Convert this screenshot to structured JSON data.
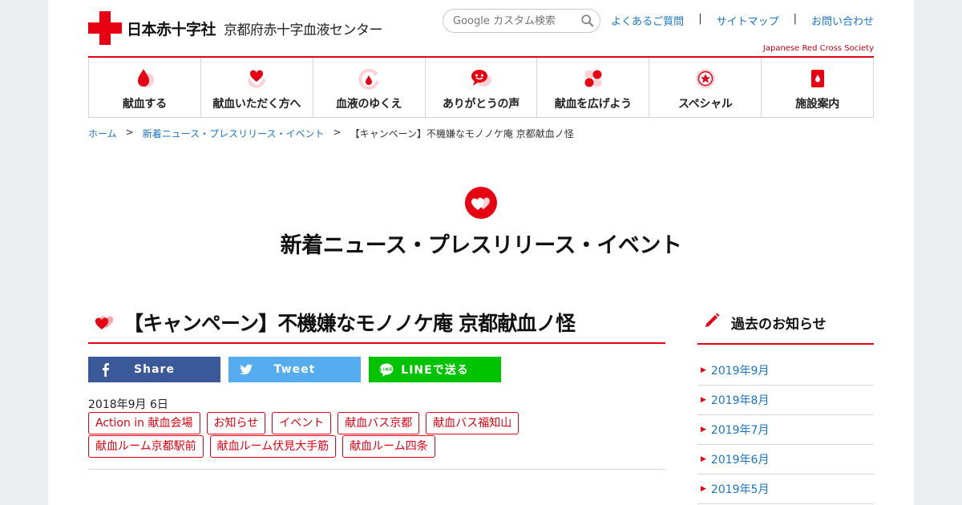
{
  "header": {
    "logo_text": "日本赤十字社",
    "center_name": "京都府赤十字血液センター",
    "search_placeholder": "Google カスタム検索",
    "links": [
      "よくあるご質問",
      "サイトマップ",
      "お問い合わせ"
    ],
    "separator": "|",
    "society_en": "Japanese Red Cross Society"
  },
  "nav": [
    {
      "label": "献血する",
      "icon": "blood-drop-icon"
    },
    {
      "label": "献血いただく方へ",
      "icon": "heart-hands-icon"
    },
    {
      "label": "血液のゆくえ",
      "icon": "circulation-icon"
    },
    {
      "label": "ありがとうの声",
      "icon": "speech-bubble-icon"
    },
    {
      "label": "献血を広げよう",
      "icon": "clover-icon"
    },
    {
      "label": "スペシャル",
      "icon": "star-badge-icon"
    },
    {
      "label": "施設案内",
      "icon": "building-card-icon"
    }
  ],
  "breadcrumb": {
    "home": "ホーム",
    "section": "新着ニュース・プレスリリース・イベント",
    "separator": ">",
    "current": "【キャンペーン】不機嫌なモノノケ庵 京都献血ノ怪"
  },
  "section": {
    "title": "新着ニュース・プレスリリース・イベント"
  },
  "article": {
    "title": "【キャンペーン】不機嫌なモノノケ庵 京都献血ノ怪",
    "share": {
      "facebook": "Share",
      "twitter": "Tweet",
      "line": "LINEで送る"
    },
    "date": "2018年9月 6日",
    "tags": [
      "Action in 献血会場",
      "お知らせ",
      "イベント",
      "献血バス京都",
      "献血バス福知山",
      "献血ルーム京都駅前",
      "献血ルーム伏見大手筋",
      "献血ルーム四条"
    ]
  },
  "sidebar": {
    "title": "過去のお知らせ",
    "archive": [
      "2019年9月",
      "2019年8月",
      "2019年7月",
      "2019年6月",
      "2019年5月"
    ]
  },
  "colors": {
    "brand_red": "#e60012",
    "link_blue": "#1a74c7",
    "facebook": "#3b5998",
    "twitter": "#55acee",
    "line": "#00c300"
  }
}
